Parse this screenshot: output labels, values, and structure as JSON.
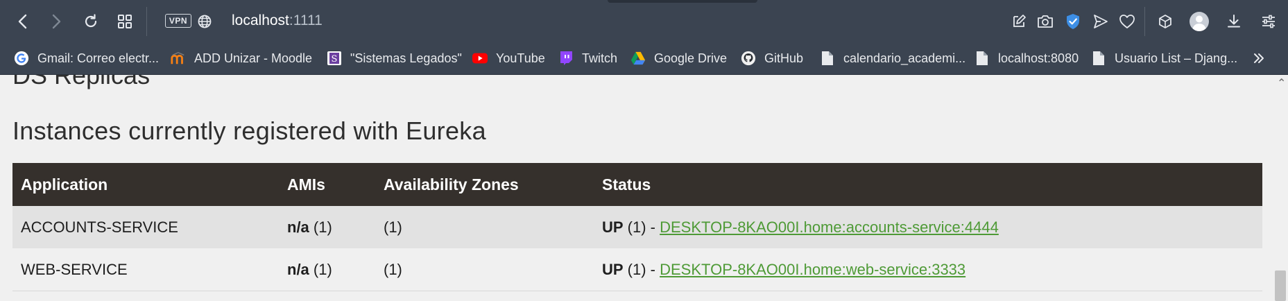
{
  "browser": {
    "url_host": "localhost",
    "url_port": ":1111",
    "vpn_label": "VPN"
  },
  "bookmarks": [
    {
      "label": "Gmail: Correo electr...",
      "icon": "gmail-icon"
    },
    {
      "label": "ADD Unizar - Moodle",
      "icon": "moodle-icon"
    },
    {
      "label": "\"Sistemas Legados\"",
      "icon": "bookmark-s-icon"
    },
    {
      "label": "YouTube",
      "icon": "youtube-icon"
    },
    {
      "label": "Twitch",
      "icon": "twitch-icon"
    },
    {
      "label": "Google Drive",
      "icon": "google-drive-icon"
    },
    {
      "label": "GitHub",
      "icon": "github-icon"
    },
    {
      "label": "calendario_academi...",
      "icon": "file-icon"
    },
    {
      "label": "localhost:8080",
      "icon": "file-icon"
    },
    {
      "label": "Usuario List – Djang...",
      "icon": "file-icon"
    }
  ],
  "page": {
    "cut_heading": "DS Replicas",
    "section_title": "Instances currently registered with Eureka",
    "columns": [
      "Application",
      "AMIs",
      "Availability Zones",
      "Status"
    ],
    "rows": [
      {
        "application": "ACCOUNTS-SERVICE",
        "ami_bold": "n/a",
        "ami_count": " (1)",
        "zones": "(1)",
        "status_bold": "UP",
        "status_count": " (1) - ",
        "instance_link": "DESKTOP-8KAO00I.home:accounts-service:4444"
      },
      {
        "application": "WEB-SERVICE",
        "ami_bold": "n/a",
        "ami_count": " (1)",
        "zones": "(1)",
        "status_bold": "UP",
        "status_count": " (1) - ",
        "instance_link": "DESKTOP-8KAO00I.home:web-service:3333"
      }
    ]
  },
  "colors": {
    "chrome_bg": "#3b4451",
    "table_header_bg": "#35302c",
    "link_green": "#4e9a36",
    "shield_blue": "#3d8fe6"
  }
}
